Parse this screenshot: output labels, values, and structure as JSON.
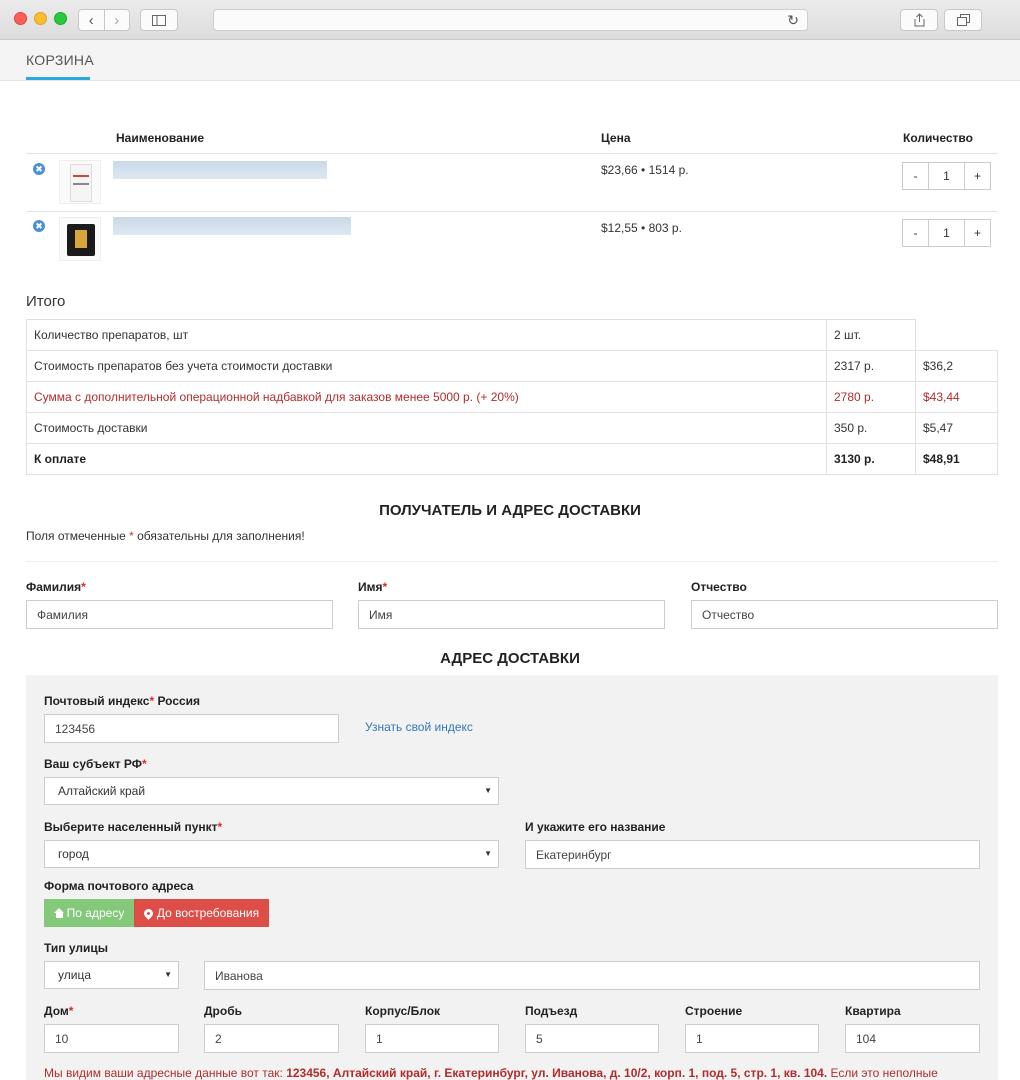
{
  "tab": {
    "label": "КОРЗИНА"
  },
  "cart": {
    "headers": {
      "name": "Наименование",
      "price": "Цена",
      "qty": "Количество"
    },
    "items": [
      {
        "price": "$23,66 • 1514 р.",
        "qty": "1",
        "minus": "-",
        "plus": "+"
      },
      {
        "price": "$12,55 • 803 р.",
        "qty": "1",
        "minus": "-",
        "plus": "+"
      }
    ]
  },
  "totals": {
    "title": "Итого",
    "rows": [
      {
        "label": "Количество препаратов, шт",
        "rub": "2 шт.",
        "usd": ""
      },
      {
        "label": "Стоимость препаратов без учета стоимости доставки",
        "rub": "2317 р.",
        "usd": "$36,2"
      },
      {
        "label": "Сумма с дополнительной операционной надбавкой для заказов менее 5000 р. (+ 20%)",
        "rub": "2780 р.",
        "usd": "$43,44"
      },
      {
        "label": "Стоимость доставки",
        "rub": "350 р.",
        "usd": "$5,47"
      },
      {
        "label": "К оплате",
        "rub": "3130 р.",
        "usd": "$48,91"
      }
    ]
  },
  "recipient": {
    "title": "ПОЛУЧАТЕЛЬ И АДРЕС ДОСТАВКИ",
    "note_before": "Поля отмеченные ",
    "note_star": "*",
    "note_after": " обязательны для заполнения!",
    "surname_label": "Фамилия",
    "surname_placeholder": "Фамилия",
    "name_label": "Имя",
    "name_placeholder": "Имя",
    "patronymic_label": "Отчество",
    "patronymic_placeholder": "Отчество",
    "required_star": "*"
  },
  "address": {
    "title": "АДРЕС ДОСТАВКИ",
    "postcode_label": "Почтовый индекс",
    "postcode_country": " Россия",
    "postcode_value": "123456",
    "postcode_link": "Узнать свой индекс",
    "region_label": "Ваш субъект РФ",
    "region_value": "Алтайский край",
    "locality_label": "Выберите населенный пункт",
    "locality_value": "город",
    "locality_name_label": "И укажите его название",
    "locality_name_value": "Екатеринбург",
    "form_label": "Форма почтового адреса",
    "btn_by_address": "По адресу",
    "btn_on_demand": "До востребования",
    "street_type_label": "Тип улицы",
    "street_type_value": "улица",
    "street_value": "Иванова",
    "house_label": "Дом",
    "house_value": "10",
    "fraction_label": "Дробь",
    "fraction_value": "2",
    "building_label": "Корпус/Блок",
    "building_value": "1",
    "entrance_label": "Подъезд",
    "entrance_value": "5",
    "structure_label": "Строение",
    "structure_value": "1",
    "apartment_label": "Квартира",
    "apartment_value": "104",
    "summary_prefix": "Мы видим ваши адресные данные вот так: ",
    "summary_bold": "123456, Алтайский край, г. Екатеринбург, ул. Иванова, д. 10/2, корп. 1, под. 5, стр. 1, кв. 104.",
    "summary_suffix": " Если это неполные"
  },
  "colors": {
    "accent": "#29a9e0",
    "link": "#3379b7",
    "warning": "#b22c2c",
    "green_button": "#84c87a",
    "red_button": "#dd4e48"
  }
}
